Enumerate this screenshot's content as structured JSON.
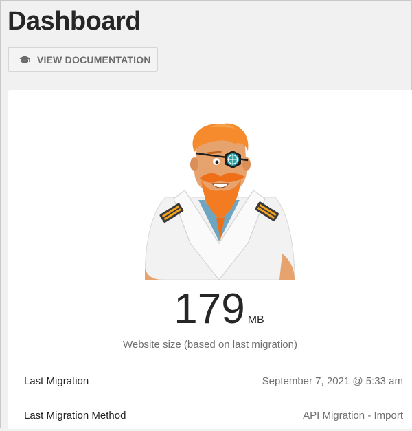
{
  "page": {
    "title": "Dashboard"
  },
  "toolbar": {
    "doc_button_label": "VIEW DOCUMENTATION",
    "doc_button_icon": "graduation-cap-icon"
  },
  "site_stats": {
    "mascot": "captain-mascot-illustration",
    "size_value": "179",
    "size_unit": "MB",
    "size_caption": "Website size (based on last migration)"
  },
  "details": [
    {
      "label": "Last Migration",
      "value": "September 7, 2021 @ 5:33 am"
    },
    {
      "label": "Last Migration Method",
      "value": "API Migration - Import"
    }
  ],
  "colors": {
    "beard": "#f37c22",
    "hair": "#f58b2c",
    "skin": "#e7a36d",
    "uniform": "#f2f2f2",
    "shirt": "#6ea6c2",
    "scope": "#2aa4a8"
  }
}
